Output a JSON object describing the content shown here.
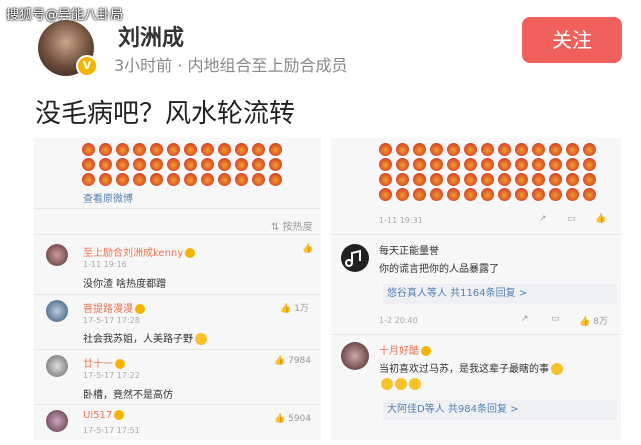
{
  "watermark": "搜狐号@异能八卦局",
  "post": {
    "author": "刘洲成",
    "meta": "3小时前 · 内地组合至上励合成员",
    "follow_label": "关注",
    "text": "没毛病吧？风水轮流转"
  },
  "left_panel": {
    "view_original": "查看原微博",
    "sort_label": "按热度",
    "comments": [
      {
        "user": "至上励合刘洲成kenny",
        "time": "1-11 19:16",
        "text": "没你渣 啥热度都蹭",
        "likes": ""
      },
      {
        "user": "菩提路漫漫",
        "time": "17-5-17 17:28",
        "text": "社会我苏姐，人美路子野",
        "likes": "1万"
      },
      {
        "user": "廿十一",
        "time": "17-5-17 17:22",
        "text": "卧槽，竟然不是高仿",
        "likes": "7984"
      },
      {
        "user": "Ui517",
        "time": "17-5-17 17:51",
        "text": "",
        "likes": "5904"
      }
    ]
  },
  "right_panel": {
    "post_time": "1-11 19:31",
    "comments": [
      {
        "user": "每天正能量誉",
        "text": "你的谎言把你的人品暴露了",
        "reply": "悠谷真人等人 共1164条回复 >",
        "time": "1-2 20:40",
        "likes": "8万"
      },
      {
        "user": "十月好酷",
        "text": "当初喜欢过马苏，是我这辈子最瞎的事",
        "reply": "大阿佳D等人 共984条回复 >",
        "time": "",
        "likes": ""
      }
    ]
  },
  "colors": {
    "follow_bg": "#f2605b",
    "link": "#5580b3",
    "username": "#eb7350"
  },
  "icons": [
    "verified-badge-icon",
    "sort-icon",
    "like-icon",
    "share-icon",
    "comment-icon",
    "laugh-emoji-icon"
  ]
}
